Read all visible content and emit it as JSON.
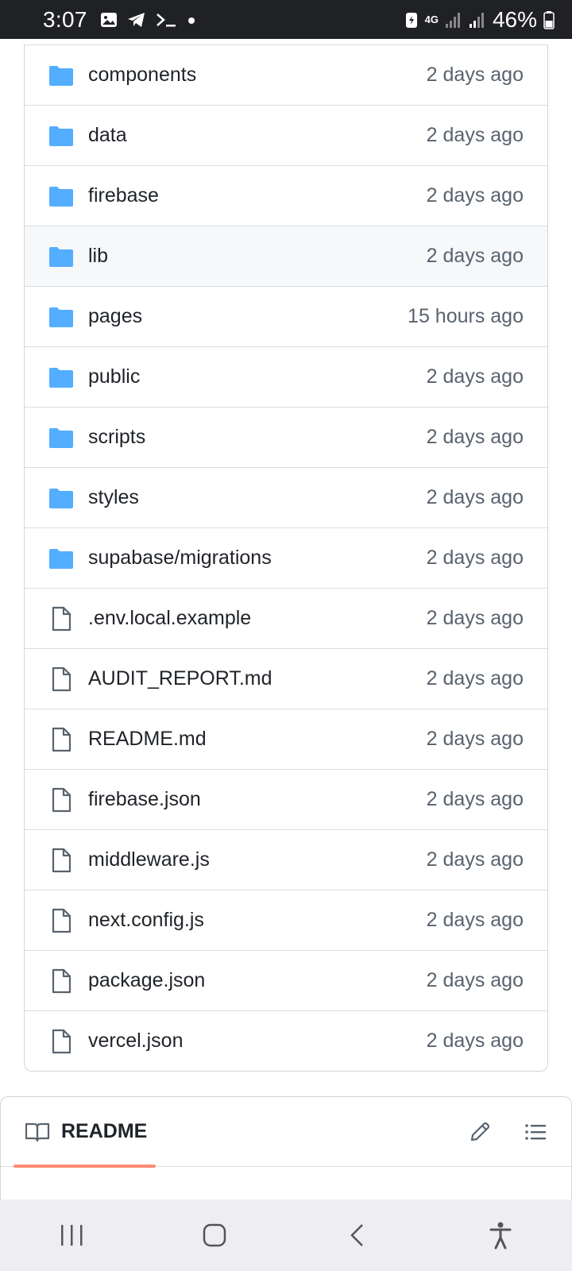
{
  "status_bar": {
    "time": "3:07",
    "battery": "46%",
    "network": "4G",
    "left_icons": [
      "image-icon",
      "telegram-icon",
      "terminal-icon",
      "dot-icon"
    ]
  },
  "files": [
    {
      "name": "components",
      "time": "2 days ago",
      "type": "folder"
    },
    {
      "name": "data",
      "time": "2 days ago",
      "type": "folder"
    },
    {
      "name": "firebase",
      "time": "2 days ago",
      "type": "folder"
    },
    {
      "name": "lib",
      "time": "2 days ago",
      "type": "folder"
    },
    {
      "name": "pages",
      "time": "15 hours ago",
      "type": "folder"
    },
    {
      "name": "public",
      "time": "2 days ago",
      "type": "folder"
    },
    {
      "name": "scripts",
      "time": "2 days ago",
      "type": "folder"
    },
    {
      "name": "styles",
      "time": "2 days ago",
      "type": "folder"
    },
    {
      "name": "supabase/migrations",
      "time": "2 days ago",
      "type": "folder"
    },
    {
      "name": ".env.local.example",
      "time": "2 days ago",
      "type": "file"
    },
    {
      "name": "AUDIT_REPORT.md",
      "time": "2 days ago",
      "type": "file"
    },
    {
      "name": "README.md",
      "time": "2 days ago",
      "type": "file"
    },
    {
      "name": "firebase.json",
      "time": "2 days ago",
      "type": "file"
    },
    {
      "name": "middleware.js",
      "time": "2 days ago",
      "type": "file"
    },
    {
      "name": "next.config.js",
      "time": "2 days ago",
      "type": "file"
    },
    {
      "name": "package.json",
      "time": "2 days ago",
      "type": "file"
    },
    {
      "name": "vercel.json",
      "time": "2 days ago",
      "type": "file"
    }
  ],
  "readme": {
    "title": "README"
  },
  "colors": {
    "folder": "#54aeff",
    "file_icon": "#59636e",
    "accent_underline": "#fd8c73"
  }
}
